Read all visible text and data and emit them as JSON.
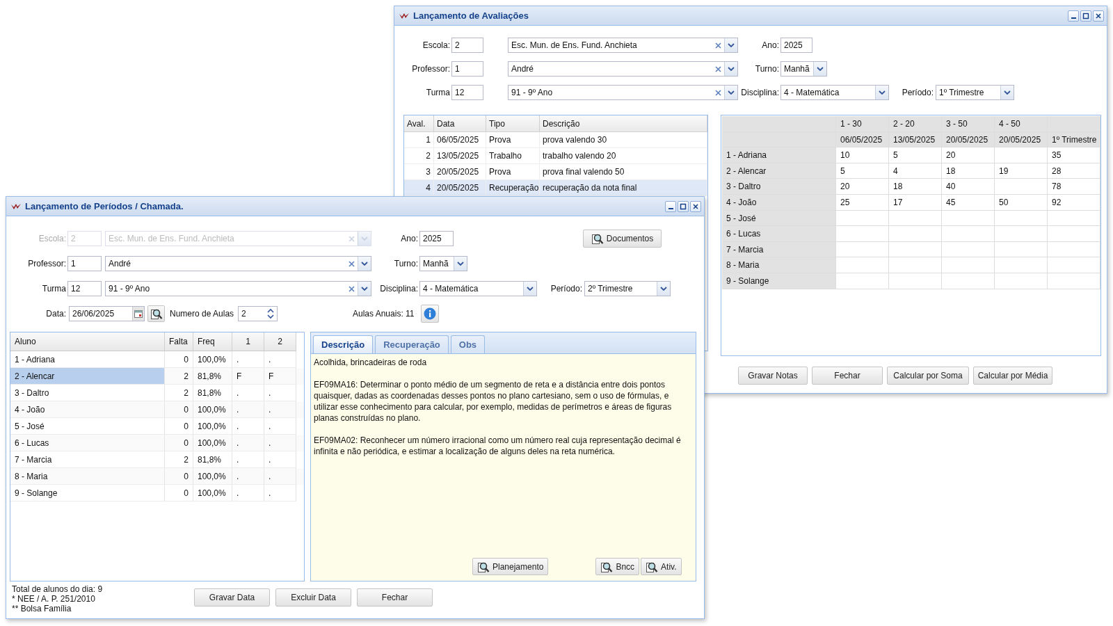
{
  "evaluations_window": {
    "title": "Lançamento de Avaliações",
    "escola": {
      "label": "Escola:",
      "code": "2",
      "name": "Esc. Mun. de Ens. Fund. Anchieta",
      "disabled": false
    },
    "professor": {
      "label": "Professor:",
      "code": "1",
      "name": "André",
      "disabled": false
    },
    "turma": {
      "label": "Turma",
      "code": "12",
      "name": "91 - 9º Ano",
      "disabled": false
    },
    "ano": {
      "label": "Ano:",
      "value": "2025"
    },
    "turno": {
      "label": "Turno:",
      "value": "Manhã"
    },
    "disciplina": {
      "label": "Disciplina:",
      "value": "4 - Matemática"
    },
    "periodo": {
      "label": "Período:",
      "value": "1º Trimestre"
    },
    "assessments": {
      "columns": [
        "Aval.",
        "Data",
        "Tipo",
        "Descrição"
      ],
      "rows": [
        {
          "cells": [
            "1",
            "06/05/2025",
            "Prova",
            "prova valendo 30"
          ],
          "selected": false
        },
        {
          "cells": [
            "2",
            "13/05/2025",
            "Trabalho",
            "trabalho valendo 20"
          ],
          "selected": false
        },
        {
          "cells": [
            "3",
            "20/05/2025",
            "Prova",
            "prova final valendo 50"
          ],
          "selected": false
        },
        {
          "cells": [
            "4",
            "20/05/2025",
            "Recuperação",
            "recuperação da nota final"
          ],
          "selected": true
        }
      ]
    },
    "grades": {
      "header_top": [
        "1 - 30",
        "2 - 20",
        "3 - 50",
        "4 - 50"
      ],
      "header_bottom": [
        "06/05/2025",
        "13/05/2025",
        "20/05/2025",
        "20/05/2025",
        "1º Trimestre"
      ],
      "rows": [
        {
          "student": "1 - Adriana",
          "av1": "10",
          "av2": "5",
          "av3": "20",
          "total": "35"
        },
        {
          "student": "2 - Alencar",
          "av1": "5",
          "av2": "4",
          "av3": "18",
          "av4": "19",
          "total": "28"
        },
        {
          "student": "3 - Daltro",
          "av1": "20",
          "av2": "18",
          "av3": "40",
          "total": "78"
        },
        {
          "student": "4 - João",
          "av1": "25",
          "av2": "17",
          "av3": "45",
          "av4": "50",
          "total": "92"
        },
        {
          "student": "5 - José"
        },
        {
          "student": "6 - Lucas"
        },
        {
          "student": "7 - Marcia"
        },
        {
          "student": "8 - Maria"
        },
        {
          "student": "9 - Solange"
        }
      ]
    },
    "buttons": [
      "Gravar Notas",
      "Fechar",
      "Calcular por Soma",
      "Calcular por Média"
    ]
  },
  "attendance_window": {
    "title": "Lançamento de Períodos / Chamada.",
    "escola": {
      "label": "Escola:",
      "code": "2",
      "name": "Esc. Mun. de Ens. Fund. Anchieta",
      "disabled": true
    },
    "professor": {
      "label": "Professor:",
      "code": "1",
      "name": "André",
      "disabled": false
    },
    "turma": {
      "label": "Turma",
      "code": "12",
      "name": "91 - 9º Ano",
      "disabled": false
    },
    "ano": {
      "label": "Ano:",
      "value": "2025"
    },
    "turno": {
      "label": "Turno:",
      "value": "Manhã"
    },
    "disciplina": {
      "label": "Disciplina:",
      "value": "4 - Matemática"
    },
    "periodo": {
      "label": "Período:",
      "value": "2º Trimestre"
    },
    "documents_button": "Documentos",
    "data": {
      "label": "Data:",
      "value": "26/06/2025"
    },
    "aulas": {
      "label": "Numero de Aulas",
      "value": "2"
    },
    "aulas_anuais": "Aulas Anuais: 11",
    "students": {
      "columns": [
        "Aluno",
        "Falta",
        "Freq",
        "1",
        "2"
      ],
      "rows": [
        {
          "cells": [
            "1 - Adriana",
            "0",
            "100,0%",
            ".",
            "."
          ],
          "selected": false
        },
        {
          "cells": [
            "2 - Alencar",
            "2",
            "81,8%",
            "F",
            "F"
          ],
          "selected": true
        },
        {
          "cells": [
            "3 - Daltro",
            "2",
            "81,8%",
            ".",
            "."
          ],
          "selected": false
        },
        {
          "cells": [
            "4 - João",
            "0",
            "100,0%",
            ".",
            "."
          ],
          "selected": false
        },
        {
          "cells": [
            "5 - José",
            "0",
            "100,0%",
            ".",
            "."
          ],
          "selected": false
        },
        {
          "cells": [
            "6 - Lucas",
            "0",
            "100,0%",
            ".",
            "."
          ],
          "selected": false
        },
        {
          "cells": [
            "7 - Marcia",
            "2",
            "81,8%",
            ".",
            "."
          ],
          "selected": false
        },
        {
          "cells": [
            "8 - Maria",
            "0",
            "100,0%",
            ".",
            "."
          ],
          "selected": false
        },
        {
          "cells": [
            "9 - Solange",
            "0",
            "100,0%",
            ".",
            "."
          ],
          "selected": false
        }
      ]
    },
    "tabs": [
      {
        "label": "Descrição",
        "selected": true
      },
      {
        "label": "Recuperação",
        "selected": false
      },
      {
        "label": "Obs",
        "selected": false
      }
    ],
    "description": [
      "Acolhida, brincadeiras de roda",
      "EF09MA16: Determinar o ponto médio de um segmento de reta e a distância entre dois pontos quaisquer, dadas as coordenadas desses pontos no plano cartesiano, sem o uso de fórmulas, e utilizar esse conhecimento para calcular, por exemplo, medidas de perímetros e áreas de figuras planas construídas no plano.",
      "EF09MA02: Reconhecer um número irracional como um número real cuja representação decimal é infinita e não periódica, e estimar a localização de alguns deles na reta numérica."
    ],
    "panel_buttons": [
      "Planejamento",
      "Bncc",
      "Ativ."
    ],
    "footer_notes": [
      "Total de alunos do dia: 9",
      "* NEE / A. P. 251/2010",
      "** Bolsa Família"
    ],
    "buttons": [
      "Gravar Data",
      "Excluir Data",
      "Fechar"
    ]
  }
}
